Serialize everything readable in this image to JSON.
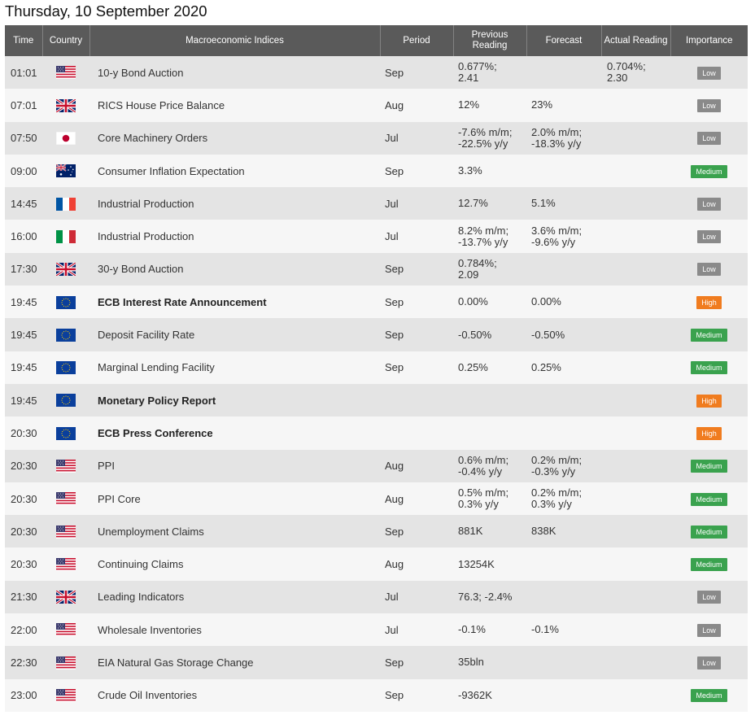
{
  "page": {
    "title": "Thursday, 10 September 2020"
  },
  "colors": {
    "header_bg": "#5a5a5a",
    "row_odd": "#e4e4e4",
    "row_even": "#f6f6f6",
    "low": "#8a8a8a",
    "medium": "#3aa24e",
    "high": "#f07c1f"
  },
  "table": {
    "headers": {
      "time": "Time",
      "country": "Country",
      "indices": "Macroeconomic Indices",
      "period": "Period",
      "previous_1": "Previous",
      "previous_2": "Reading",
      "forecast": "Forecast",
      "actual": "Actual Reading",
      "importance": "Importance"
    },
    "rows": [
      {
        "time": "01:01",
        "flag": "us",
        "name": "10-y Bond Auction",
        "bold": false,
        "period": "Sep",
        "prev1": "0.677%;",
        "prev2": "2.41",
        "fc1": "",
        "fc2": "",
        "act1": "0.704%;",
        "act2": "2.30",
        "importance": "Low",
        "level": "low"
      },
      {
        "time": "07:01",
        "flag": "uk",
        "name": "RICS House Price Balance",
        "bold": false,
        "period": "Aug",
        "prev1": "12%",
        "prev2": "",
        "fc1": "23%",
        "fc2": "",
        "act1": "",
        "act2": "",
        "importance": "Low",
        "level": "low"
      },
      {
        "time": "07:50",
        "flag": "jp",
        "name": "Core Machinery Orders",
        "bold": false,
        "period": "Jul",
        "prev1": "-7.6% m/m;",
        "prev2": "-22.5% y/y",
        "fc1": "2.0% m/m;",
        "fc2": "-18.3% y/y",
        "act1": "",
        "act2": "",
        "importance": "Low",
        "level": "low"
      },
      {
        "time": "09:00",
        "flag": "au",
        "name": "Consumer Inflation Expectation",
        "bold": false,
        "period": "Sep",
        "prev1": "3.3%",
        "prev2": "",
        "fc1": "",
        "fc2": "",
        "act1": "",
        "act2": "",
        "importance": "Medium",
        "level": "medium"
      },
      {
        "time": "14:45",
        "flag": "fr",
        "name": "Industrial Production",
        "bold": false,
        "period": "Jul",
        "prev1": "12.7%",
        "prev2": "",
        "fc1": "5.1%",
        "fc2": "",
        "act1": "",
        "act2": "",
        "importance": "Low",
        "level": "low"
      },
      {
        "time": "16:00",
        "flag": "it",
        "name": "Industrial Production",
        "bold": false,
        "period": "Jul",
        "prev1": "8.2% m/m;",
        "prev2": "-13.7% y/y",
        "fc1": "3.6% m/m;",
        "fc2": "-9.6% y/y",
        "act1": "",
        "act2": "",
        "importance": "Low",
        "level": "low"
      },
      {
        "time": "17:30",
        "flag": "uk",
        "name": "30-y Bond Auction",
        "bold": false,
        "period": "Sep",
        "prev1": "0.784%;",
        "prev2": "2.09",
        "fc1": "",
        "fc2": "",
        "act1": "",
        "act2": "",
        "importance": "Low",
        "level": "low"
      },
      {
        "time": "19:45",
        "flag": "eu",
        "name": "ECB Interest Rate Announcement",
        "bold": true,
        "period": "Sep",
        "prev1": "0.00%",
        "prev2": "",
        "fc1": "0.00%",
        "fc2": "",
        "act1": "",
        "act2": "",
        "importance": "High",
        "level": "high"
      },
      {
        "time": "19:45",
        "flag": "eu",
        "name": "Deposit Facility Rate",
        "bold": false,
        "period": "Sep",
        "prev1": "-0.50%",
        "prev2": "",
        "fc1": "-0.50%",
        "fc2": "",
        "act1": "",
        "act2": "",
        "importance": "Medium",
        "level": "medium"
      },
      {
        "time": "19:45",
        "flag": "eu",
        "name": "Marginal Lending Facility",
        "bold": false,
        "period": "Sep",
        "prev1": "0.25%",
        "prev2": "",
        "fc1": "0.25%",
        "fc2": "",
        "act1": "",
        "act2": "",
        "importance": "Medium",
        "level": "medium"
      },
      {
        "time": "19:45",
        "flag": "eu",
        "name": "Monetary Policy Report",
        "bold": true,
        "period": "",
        "prev1": "",
        "prev2": "",
        "fc1": "",
        "fc2": "",
        "act1": "",
        "act2": "",
        "importance": "High",
        "level": "high"
      },
      {
        "time": "20:30",
        "flag": "eu",
        "name": "ECB Press Conference",
        "bold": true,
        "period": "",
        "prev1": "",
        "prev2": "",
        "fc1": "",
        "fc2": "",
        "act1": "",
        "act2": "",
        "importance": "High",
        "level": "high"
      },
      {
        "time": "20:30",
        "flag": "us",
        "name": "PPI",
        "bold": false,
        "period": "Aug",
        "prev1": "0.6% m/m;",
        "prev2": "-0.4% y/y",
        "fc1": "0.2% m/m;",
        "fc2": "-0.3% y/y",
        "act1": "",
        "act2": "",
        "importance": "Medium",
        "level": "medium"
      },
      {
        "time": "20:30",
        "flag": "us",
        "name": "PPI Core",
        "bold": false,
        "period": "Aug",
        "prev1": "0.5% m/m;",
        "prev2": "0.3% y/y",
        "fc1": "0.2% m/m;",
        "fc2": "0.3% y/y",
        "act1": "",
        "act2": "",
        "importance": "Medium",
        "level": "medium"
      },
      {
        "time": "20:30",
        "flag": "us",
        "name": "Unemployment Claims",
        "bold": false,
        "period": "Sep",
        "prev1": "881K",
        "prev2": "",
        "fc1": "838K",
        "fc2": "",
        "act1": "",
        "act2": "",
        "importance": "Medium",
        "level": "medium"
      },
      {
        "time": "20:30",
        "flag": "us",
        "name": "Continuing Claims",
        "bold": false,
        "period": "Aug",
        "prev1": "13254K",
        "prev2": "",
        "fc1": "",
        "fc2": "",
        "act1": "",
        "act2": "",
        "importance": "Medium",
        "level": "medium"
      },
      {
        "time": "21:30",
        "flag": "uk",
        "name": "Leading Indicators",
        "bold": false,
        "period": "Jul",
        "prev1": "76.3; -2.4%",
        "prev2": "",
        "fc1": "",
        "fc2": "",
        "act1": "",
        "act2": "",
        "importance": "Low",
        "level": "low"
      },
      {
        "time": "22:00",
        "flag": "us",
        "name": "Wholesale Inventories",
        "bold": false,
        "period": "Jul",
        "prev1": "-0.1%",
        "prev2": "",
        "fc1": "-0.1%",
        "fc2": "",
        "act1": "",
        "act2": "",
        "importance": "Low",
        "level": "low"
      },
      {
        "time": "22:30",
        "flag": "us",
        "name": "EIA Natural Gas Storage Change",
        "bold": false,
        "period": "Sep",
        "prev1": "35bln",
        "prev2": "",
        "fc1": "",
        "fc2": "",
        "act1": "",
        "act2": "",
        "importance": "Low",
        "level": "low"
      },
      {
        "time": "23:00",
        "flag": "us",
        "name": "Crude Oil Inventories",
        "bold": false,
        "period": "Sep",
        "prev1": "-9362K",
        "prev2": "",
        "fc1": "",
        "fc2": "",
        "act1": "",
        "act2": "",
        "importance": "Medium",
        "level": "medium"
      }
    ]
  }
}
